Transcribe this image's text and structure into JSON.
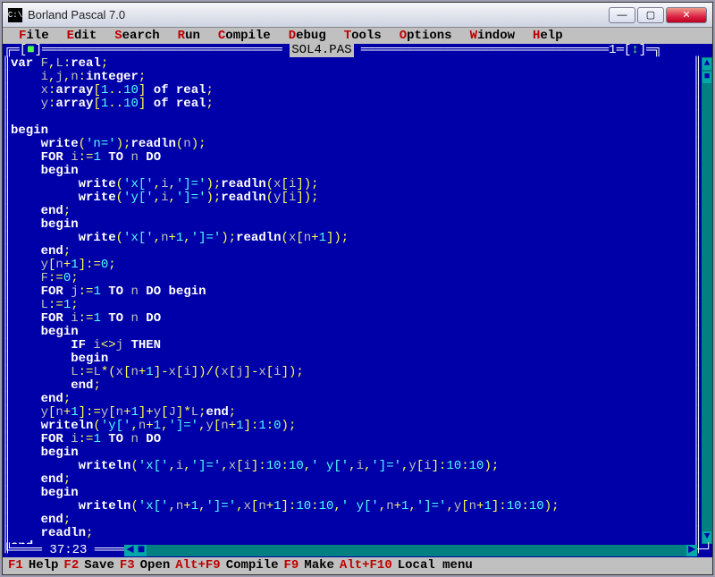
{
  "window": {
    "title": "Borland Pascal 7.0"
  },
  "menubar": [
    {
      "hot": "F",
      "rest": "ile"
    },
    {
      "hot": "E",
      "rest": "dit"
    },
    {
      "hot": "S",
      "rest": "earch"
    },
    {
      "hot": "R",
      "rest": "un"
    },
    {
      "hot": "C",
      "rest": "ompile"
    },
    {
      "hot": "D",
      "rest": "ebug"
    },
    {
      "hot": "T",
      "rest": "ools"
    },
    {
      "hot": "O",
      "rest": "ptions"
    },
    {
      "hot": "W",
      "rest": "indow"
    },
    {
      "hot": "H",
      "rest": "elp"
    }
  ],
  "file": {
    "name": "SOL4.PAS",
    "window_number": "1"
  },
  "code": [
    [
      [
        "kw",
        "var"
      ],
      [
        "txt",
        " F"
      ],
      [
        "sym",
        ","
      ],
      [
        "txt",
        "L"
      ],
      [
        "sym",
        ":"
      ],
      [
        "kw",
        "real"
      ],
      [
        "sym",
        ";"
      ]
    ],
    [
      [
        "txt",
        "    i"
      ],
      [
        "sym",
        ","
      ],
      [
        "txt",
        "j"
      ],
      [
        "sym",
        ","
      ],
      [
        "txt",
        "n"
      ],
      [
        "sym",
        ":"
      ],
      [
        "kw",
        "integer"
      ],
      [
        "sym",
        ";"
      ]
    ],
    [
      [
        "txt",
        "    x"
      ],
      [
        "sym",
        ":"
      ],
      [
        "kw",
        "array"
      ],
      [
        "sym",
        "["
      ],
      [
        "num",
        "1"
      ],
      [
        "sym",
        ".."
      ],
      [
        "num",
        "10"
      ],
      [
        "sym",
        "]"
      ],
      [
        "txt",
        " "
      ],
      [
        "kw",
        "of"
      ],
      [
        "txt",
        " "
      ],
      [
        "kw",
        "real"
      ],
      [
        "sym",
        ";"
      ]
    ],
    [
      [
        "txt",
        "    y"
      ],
      [
        "sym",
        ":"
      ],
      [
        "kw",
        "array"
      ],
      [
        "sym",
        "["
      ],
      [
        "num",
        "1"
      ],
      [
        "sym",
        ".."
      ],
      [
        "num",
        "10"
      ],
      [
        "sym",
        "]"
      ],
      [
        "txt",
        " "
      ],
      [
        "kw",
        "of"
      ],
      [
        "txt",
        " "
      ],
      [
        "kw",
        "real"
      ],
      [
        "sym",
        ";"
      ]
    ],
    [
      [
        "txt",
        ""
      ]
    ],
    [
      [
        "kw",
        "begin"
      ]
    ],
    [
      [
        "txt",
        "    "
      ],
      [
        "kw",
        "write"
      ],
      [
        "sym",
        "("
      ],
      [
        "str",
        "'n='"
      ],
      [
        "sym",
        ");"
      ],
      [
        "kw",
        "readln"
      ],
      [
        "sym",
        "("
      ],
      [
        "txt",
        "n"
      ],
      [
        "sym",
        ");"
      ]
    ],
    [
      [
        "txt",
        "    "
      ],
      [
        "kw",
        "FOR"
      ],
      [
        "txt",
        " i"
      ],
      [
        "sym",
        ":="
      ],
      [
        "num",
        "1"
      ],
      [
        "txt",
        " "
      ],
      [
        "kw",
        "TO"
      ],
      [
        "txt",
        " n "
      ],
      [
        "kw",
        "DO"
      ]
    ],
    [
      [
        "txt",
        "    "
      ],
      [
        "kw",
        "begin"
      ]
    ],
    [
      [
        "txt",
        "         "
      ],
      [
        "kw",
        "write"
      ],
      [
        "sym",
        "("
      ],
      [
        "str",
        "'x['"
      ],
      [
        "sym",
        ","
      ],
      [
        "txt",
        "i"
      ],
      [
        "sym",
        ","
      ],
      [
        "str",
        "']='"
      ],
      [
        "sym",
        ");"
      ],
      [
        "kw",
        "readln"
      ],
      [
        "sym",
        "("
      ],
      [
        "txt",
        "x"
      ],
      [
        "sym",
        "["
      ],
      [
        "txt",
        "i"
      ],
      [
        "sym",
        "]);"
      ]
    ],
    [
      [
        "txt",
        "         "
      ],
      [
        "kw",
        "write"
      ],
      [
        "sym",
        "("
      ],
      [
        "str",
        "'y['"
      ],
      [
        "sym",
        ","
      ],
      [
        "txt",
        "i"
      ],
      [
        "sym",
        ","
      ],
      [
        "str",
        "']='"
      ],
      [
        "sym",
        ");"
      ],
      [
        "kw",
        "readln"
      ],
      [
        "sym",
        "("
      ],
      [
        "txt",
        "y"
      ],
      [
        "sym",
        "["
      ],
      [
        "txt",
        "i"
      ],
      [
        "sym",
        "]);"
      ]
    ],
    [
      [
        "txt",
        "    "
      ],
      [
        "kw",
        "end"
      ],
      [
        "sym",
        ";"
      ]
    ],
    [
      [
        "txt",
        "    "
      ],
      [
        "kw",
        "begin"
      ]
    ],
    [
      [
        "txt",
        "         "
      ],
      [
        "kw",
        "write"
      ],
      [
        "sym",
        "("
      ],
      [
        "str",
        "'x['"
      ],
      [
        "sym",
        ","
      ],
      [
        "txt",
        "n"
      ],
      [
        "sym",
        "+"
      ],
      [
        "num",
        "1"
      ],
      [
        "sym",
        ","
      ],
      [
        "str",
        "']='"
      ],
      [
        "sym",
        ");"
      ],
      [
        "kw",
        "readln"
      ],
      [
        "sym",
        "("
      ],
      [
        "txt",
        "x"
      ],
      [
        "sym",
        "["
      ],
      [
        "txt",
        "n"
      ],
      [
        "sym",
        "+"
      ],
      [
        "num",
        "1"
      ],
      [
        "sym",
        "]);"
      ]
    ],
    [
      [
        "txt",
        "    "
      ],
      [
        "kw",
        "end"
      ],
      [
        "sym",
        ";"
      ]
    ],
    [
      [
        "txt",
        "    y"
      ],
      [
        "sym",
        "["
      ],
      [
        "txt",
        "n"
      ],
      [
        "sym",
        "+"
      ],
      [
        "num",
        "1"
      ],
      [
        "sym",
        "]:="
      ],
      [
        "num",
        "0"
      ],
      [
        "sym",
        ";"
      ]
    ],
    [
      [
        "txt",
        "    F"
      ],
      [
        "sym",
        ":="
      ],
      [
        "num",
        "0"
      ],
      [
        "sym",
        ";"
      ]
    ],
    [
      [
        "txt",
        "    "
      ],
      [
        "kw",
        "FOR"
      ],
      [
        "txt",
        " j"
      ],
      [
        "sym",
        ":="
      ],
      [
        "num",
        "1"
      ],
      [
        "txt",
        " "
      ],
      [
        "kw",
        "TO"
      ],
      [
        "txt",
        " n "
      ],
      [
        "kw",
        "DO"
      ],
      [
        "txt",
        " "
      ],
      [
        "kw",
        "begin"
      ]
    ],
    [
      [
        "txt",
        "    L"
      ],
      [
        "sym",
        ":="
      ],
      [
        "num",
        "1"
      ],
      [
        "sym",
        ";"
      ]
    ],
    [
      [
        "txt",
        "    "
      ],
      [
        "kw",
        "FOR"
      ],
      [
        "txt",
        " i"
      ],
      [
        "sym",
        ":="
      ],
      [
        "num",
        "1"
      ],
      [
        "txt",
        " "
      ],
      [
        "kw",
        "TO"
      ],
      [
        "txt",
        " n "
      ],
      [
        "kw",
        "DO"
      ]
    ],
    [
      [
        "txt",
        "    "
      ],
      [
        "kw",
        "begin"
      ]
    ],
    [
      [
        "txt",
        "        "
      ],
      [
        "kw",
        "IF"
      ],
      [
        "txt",
        " i"
      ],
      [
        "sym",
        "<>"
      ],
      [
        "txt",
        "j "
      ],
      [
        "kw",
        "THEN"
      ]
    ],
    [
      [
        "txt",
        "        "
      ],
      [
        "kw",
        "begin"
      ]
    ],
    [
      [
        "txt",
        "        L"
      ],
      [
        "sym",
        ":="
      ],
      [
        "txt",
        "L"
      ],
      [
        "sym",
        "*("
      ],
      [
        "txt",
        "x"
      ],
      [
        "sym",
        "["
      ],
      [
        "txt",
        "n"
      ],
      [
        "sym",
        "+"
      ],
      [
        "num",
        "1"
      ],
      [
        "sym",
        "]-"
      ],
      [
        "txt",
        "x"
      ],
      [
        "sym",
        "["
      ],
      [
        "txt",
        "i"
      ],
      [
        "sym",
        "])/("
      ],
      [
        "txt",
        "x"
      ],
      [
        "sym",
        "["
      ],
      [
        "txt",
        "j"
      ],
      [
        "sym",
        "]-"
      ],
      [
        "txt",
        "x"
      ],
      [
        "sym",
        "["
      ],
      [
        "txt",
        "i"
      ],
      [
        "sym",
        "]);"
      ]
    ],
    [
      [
        "txt",
        "        "
      ],
      [
        "kw",
        "end"
      ],
      [
        "sym",
        ";"
      ]
    ],
    [
      [
        "txt",
        "    "
      ],
      [
        "kw",
        "end"
      ],
      [
        "sym",
        ";"
      ]
    ],
    [
      [
        "txt",
        "    y"
      ],
      [
        "sym",
        "["
      ],
      [
        "txt",
        "n"
      ],
      [
        "sym",
        "+"
      ],
      [
        "num",
        "1"
      ],
      [
        "sym",
        "]:="
      ],
      [
        "txt",
        "y"
      ],
      [
        "sym",
        "["
      ],
      [
        "txt",
        "n"
      ],
      [
        "sym",
        "+"
      ],
      [
        "num",
        "1"
      ],
      [
        "sym",
        "]+"
      ],
      [
        "txt",
        "y"
      ],
      [
        "sym",
        "["
      ],
      [
        "txt",
        "J"
      ],
      [
        "sym",
        "]*"
      ],
      [
        "txt",
        "L"
      ],
      [
        "sym",
        ";"
      ],
      [
        "kw",
        "end"
      ],
      [
        "sym",
        ";"
      ]
    ],
    [
      [
        "txt",
        "    "
      ],
      [
        "kw",
        "writeln"
      ],
      [
        "sym",
        "("
      ],
      [
        "str",
        "'y['"
      ],
      [
        "sym",
        ","
      ],
      [
        "txt",
        "n"
      ],
      [
        "sym",
        "+"
      ],
      [
        "num",
        "1"
      ],
      [
        "sym",
        ","
      ],
      [
        "str",
        "']='"
      ],
      [
        "sym",
        ","
      ],
      [
        "txt",
        "y"
      ],
      [
        "sym",
        "["
      ],
      [
        "txt",
        "n"
      ],
      [
        "sym",
        "+"
      ],
      [
        "num",
        "1"
      ],
      [
        "sym",
        "]:"
      ],
      [
        "num",
        "1"
      ],
      [
        "sym",
        ":"
      ],
      [
        "num",
        "0"
      ],
      [
        "sym",
        ");"
      ]
    ],
    [
      [
        "txt",
        "    "
      ],
      [
        "kw",
        "FOR"
      ],
      [
        "txt",
        " i"
      ],
      [
        "sym",
        ":="
      ],
      [
        "num",
        "1"
      ],
      [
        "txt",
        " "
      ],
      [
        "kw",
        "TO"
      ],
      [
        "txt",
        " n "
      ],
      [
        "kw",
        "DO"
      ]
    ],
    [
      [
        "txt",
        "    "
      ],
      [
        "kw",
        "begin"
      ]
    ],
    [
      [
        "txt",
        "         "
      ],
      [
        "kw",
        "writeln"
      ],
      [
        "sym",
        "("
      ],
      [
        "str",
        "'x['"
      ],
      [
        "sym",
        ","
      ],
      [
        "txt",
        "i"
      ],
      [
        "sym",
        ","
      ],
      [
        "str",
        "']='"
      ],
      [
        "sym",
        ","
      ],
      [
        "txt",
        "x"
      ],
      [
        "sym",
        "["
      ],
      [
        "txt",
        "i"
      ],
      [
        "sym",
        "]:"
      ],
      [
        "num",
        "10"
      ],
      [
        "sym",
        ":"
      ],
      [
        "num",
        "10"
      ],
      [
        "sym",
        ","
      ],
      [
        "str",
        "' y['"
      ],
      [
        "sym",
        ","
      ],
      [
        "txt",
        "i"
      ],
      [
        "sym",
        ","
      ],
      [
        "str",
        "']='"
      ],
      [
        "sym",
        ","
      ],
      [
        "txt",
        "y"
      ],
      [
        "sym",
        "["
      ],
      [
        "txt",
        "i"
      ],
      [
        "sym",
        "]:"
      ],
      [
        "num",
        "10"
      ],
      [
        "sym",
        ":"
      ],
      [
        "num",
        "10"
      ],
      [
        "sym",
        ");"
      ]
    ],
    [
      [
        "txt",
        "    "
      ],
      [
        "kw",
        "end"
      ],
      [
        "sym",
        ";"
      ]
    ],
    [
      [
        "txt",
        "    "
      ],
      [
        "kw",
        "begin"
      ]
    ],
    [
      [
        "txt",
        "         "
      ],
      [
        "kw",
        "writeln"
      ],
      [
        "sym",
        "("
      ],
      [
        "str",
        "'x['"
      ],
      [
        "sym",
        ","
      ],
      [
        "txt",
        "n"
      ],
      [
        "sym",
        "+"
      ],
      [
        "num",
        "1"
      ],
      [
        "sym",
        ","
      ],
      [
        "str",
        "']='"
      ],
      [
        "sym",
        ","
      ],
      [
        "txt",
        "x"
      ],
      [
        "sym",
        "["
      ],
      [
        "txt",
        "n"
      ],
      [
        "sym",
        "+"
      ],
      [
        "num",
        "1"
      ],
      [
        "sym",
        "]:"
      ],
      [
        "num",
        "10"
      ],
      [
        "sym",
        ":"
      ],
      [
        "num",
        "10"
      ],
      [
        "sym",
        ","
      ],
      [
        "str",
        "' y['"
      ],
      [
        "sym",
        ","
      ],
      [
        "txt",
        "n"
      ],
      [
        "sym",
        "+"
      ],
      [
        "num",
        "1"
      ],
      [
        "sym",
        ","
      ],
      [
        "str",
        "']='"
      ],
      [
        "sym",
        ","
      ],
      [
        "txt",
        "y"
      ],
      [
        "sym",
        "["
      ],
      [
        "txt",
        "n"
      ],
      [
        "sym",
        "+"
      ],
      [
        "num",
        "1"
      ],
      [
        "sym",
        "]:"
      ],
      [
        "num",
        "10"
      ],
      [
        "sym",
        ":"
      ],
      [
        "num",
        "10"
      ],
      [
        "sym",
        ");"
      ]
    ],
    [
      [
        "txt",
        "    "
      ],
      [
        "kw",
        "end"
      ],
      [
        "sym",
        ";"
      ]
    ],
    [
      [
        "txt",
        "    "
      ],
      [
        "kw",
        "readln"
      ],
      [
        "sym",
        ";"
      ]
    ],
    [
      [
        "kw",
        "end"
      ],
      [
        "sym",
        "."
      ]
    ]
  ],
  "cursor": {
    "pos": "37:23"
  },
  "statusbar": [
    {
      "key": "F1",
      "text": " Help"
    },
    {
      "key": "F2",
      "text": " Save"
    },
    {
      "key": "F3",
      "text": " Open"
    },
    {
      "key": "Alt+F9",
      "text": " Compile"
    },
    {
      "key": "F9",
      "text": " Make"
    },
    {
      "key": "Alt+F10",
      "text": " Local menu"
    }
  ]
}
